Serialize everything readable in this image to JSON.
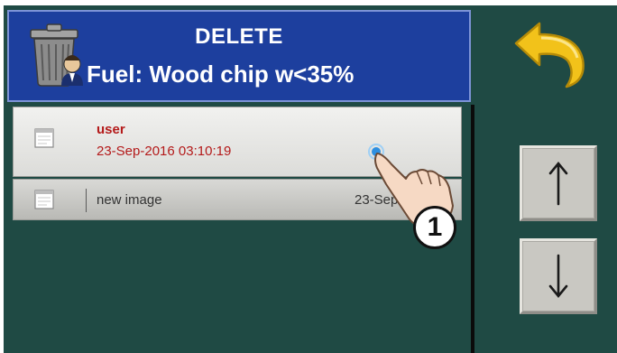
{
  "header": {
    "title": "DELETE",
    "subtitle": "Fuel: Wood chip w<35%"
  },
  "list": {
    "items": [
      {
        "name": "user",
        "date": "23-Sep-2016 03:10:19"
      },
      {
        "name": "new image",
        "date": "23-Sep-2016"
      }
    ]
  },
  "callout": {
    "label": "1"
  },
  "icons": {
    "header": "trash-can-icon",
    "back": "back-arrow-icon",
    "up": "arrow-up-icon",
    "down": "arrow-down-icon",
    "row": "file-icon",
    "touch": "pointing-hand-icon"
  },
  "colors": {
    "background": "#1f4a44",
    "header": "#1d3f9e",
    "selected_text": "#b41a1a",
    "back_arrow": "#f2c21a"
  }
}
